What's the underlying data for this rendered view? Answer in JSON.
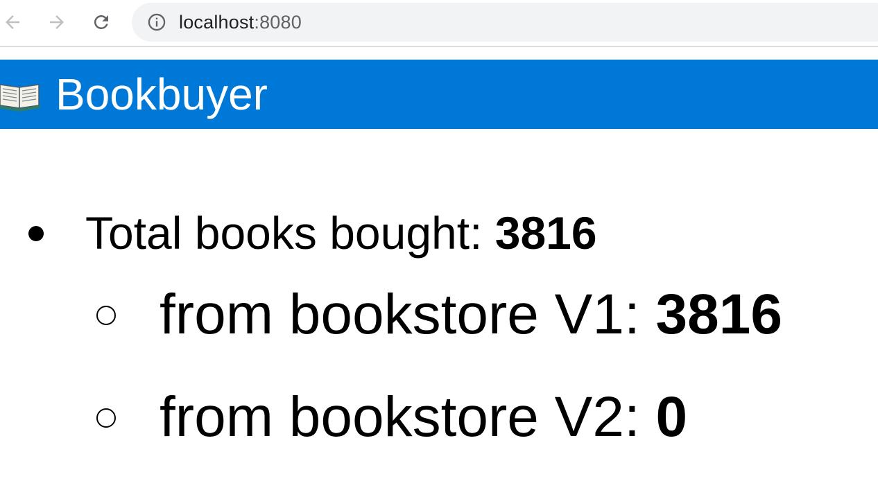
{
  "browser": {
    "url_host": "localhost",
    "url_port": ":8080",
    "icons": {
      "back": "arrow-left-icon",
      "forward": "arrow-right-icon",
      "reload": "reload-icon",
      "site_info": "info-icon"
    }
  },
  "header": {
    "icon": "open-book-icon",
    "title": "Bookbuyer",
    "background_color": "#0078d7"
  },
  "stats": {
    "total_label": "Total books bought: ",
    "total_value": "3816",
    "sources": [
      {
        "label": "from bookstore V1: ",
        "value": "3816"
      },
      {
        "label": "from bookstore V2: ",
        "value": "0"
      }
    ]
  }
}
